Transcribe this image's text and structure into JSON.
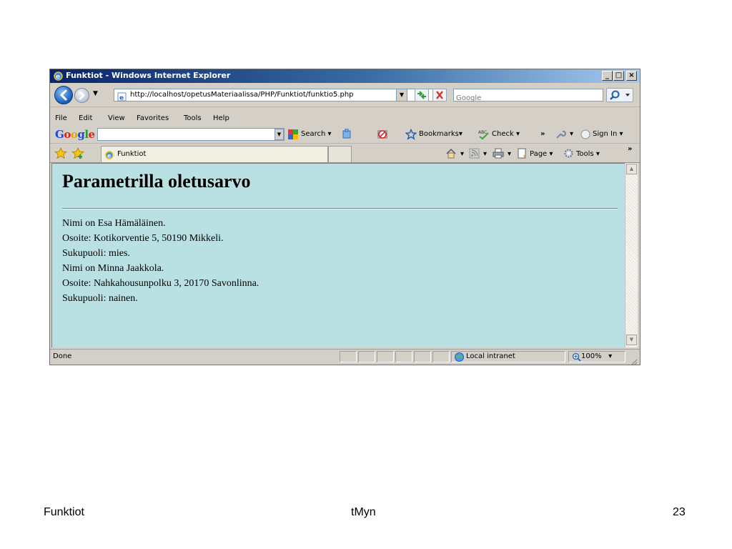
{
  "window": {
    "title": "Funktiot - Windows Internet Explorer",
    "controls": {
      "minimize": "_",
      "maximize": "□",
      "close": "×"
    }
  },
  "address_bar": {
    "url": "http://localhost/opetusMateriaalissa/PHP/Funktiot/funktio5.php",
    "search_placeholder": "Google"
  },
  "menu": [
    {
      "label": "File"
    },
    {
      "label": "Edit"
    },
    {
      "label": "View"
    },
    {
      "label": "Favorites"
    },
    {
      "label": "Tools"
    },
    {
      "label": "Help"
    }
  ],
  "google_toolbar": {
    "logo": "Google",
    "search_label": "Search",
    "bookmarks_label": "Bookmarks",
    "check_label": "Check",
    "more": "»",
    "sign_in_label": "Sign In"
  },
  "tabs": {
    "active_label": "Funktiot"
  },
  "command_bar": {
    "page_label": "Page",
    "tools_label": "Tools",
    "more": "»"
  },
  "content": {
    "heading": "Parametrilla oletusarvo",
    "lines": [
      "Nimi on Esa Hämäläinen.",
      "Osoite: Kotikorventie 5, 50190 Mikkeli.",
      "Sukupuoli: mies.",
      "Nimi on Minna Jaakkola.",
      "Osoite: Nahkahousunpolku 3, 20170 Savonlinna.",
      "Sukupuoli: nainen."
    ],
    "background_color": "#b9e0e3"
  },
  "status_bar": {
    "status": "Done",
    "zone": "Local intranet",
    "zoom": "100%"
  },
  "slide_footer": {
    "left": "Funktiot",
    "center": "tMyn",
    "page_number": "23"
  },
  "icons": [
    "ie-logo-icon",
    "back-arrow-icon",
    "forward-arrow-icon",
    "page-icon",
    "refresh-icon",
    "stop-icon",
    "search-magnifier-icon",
    "google-search-icon",
    "puzzle-icon",
    "popup-block-icon",
    "star-icon",
    "spellcheck-icon",
    "wrench-icon",
    "favorites-star-icon",
    "add-favorites-icon",
    "home-icon",
    "feeds-icon",
    "print-icon",
    "page-menu-icon",
    "tools-gear-icon",
    "intranet-globe-icon",
    "zoom-icon"
  ]
}
